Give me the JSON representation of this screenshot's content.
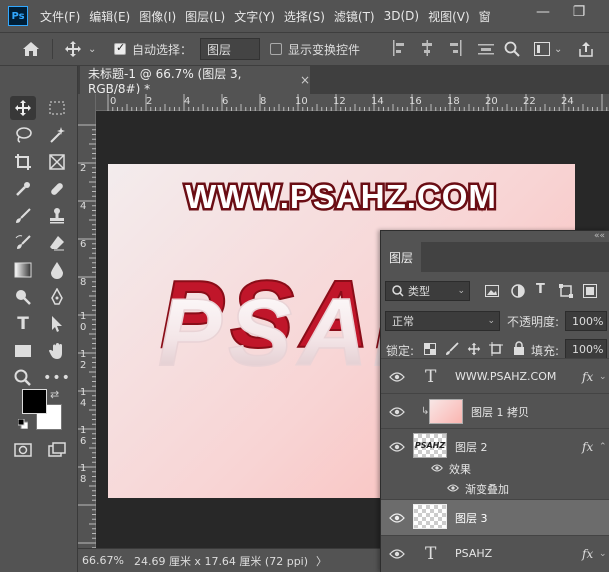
{
  "app": {
    "logo": "Ps"
  },
  "menu": [
    "文件(F)",
    "编辑(E)",
    "图像(I)",
    "图层(L)",
    "文字(Y)",
    "选择(S)",
    "滤镜(T)",
    "3D(D)",
    "视图(V)",
    "窗"
  ],
  "window_controls": {
    "minimize": "—",
    "restore": "❐"
  },
  "options": {
    "auto_select_label": "自动选择：",
    "auto_select_checked": true,
    "auto_select_target": "图层",
    "show_transform_label": "显示变换控件",
    "show_transform_checked": false
  },
  "tab": {
    "title": "未标题-1 @ 66.7% (图层 3, RGB/8#) *",
    "close": "×"
  },
  "ruler": {
    "h_labels": [
      "0",
      "2",
      "4",
      "6",
      "8",
      "10",
      "12",
      "14",
      "16",
      "18",
      "20",
      "22",
      "24"
    ],
    "v_labels": [
      "2",
      "4",
      "6",
      "8",
      "1\n0",
      "1\n2",
      "1\n4",
      "1\n6",
      "1\n8"
    ]
  },
  "canvas": {
    "watermark": "WWW.PSAHZ.COM",
    "big_text": "PSAHZ"
  },
  "status": {
    "zoom": "66.67%",
    "doc_info": "24.69 厘米 x 17.64 厘米 (72 ppi)",
    "arrow": "〉"
  },
  "layers_panel": {
    "tab_label": "图层",
    "filter_label": "类型",
    "blend_mode": "正常",
    "opacity_label": "不透明度:",
    "opacity_value": "100%",
    "lock_label": "锁定:",
    "fill_label": "填充:",
    "fill_value": "100%",
    "layers": [
      {
        "name": "WWW.PSAHZ.COM",
        "type": "text",
        "fx": "fx"
      },
      {
        "name": "图层 1 拷贝",
        "type": "gradient"
      },
      {
        "name": "图层 2",
        "type": "image",
        "fx": "fx",
        "thumb_text": "PSAHZ"
      },
      {
        "name": "图层 3",
        "type": "empty",
        "selected": true
      },
      {
        "name": "PSAHZ",
        "type": "text",
        "fx": "fx"
      }
    ],
    "effects_label": "效果",
    "gradient_overlay_label": "渐变叠加"
  },
  "colors": {
    "accent": "#31a8ff",
    "foreground": "#000000",
    "background": "#ffffff",
    "text_red": "#c0162a"
  }
}
